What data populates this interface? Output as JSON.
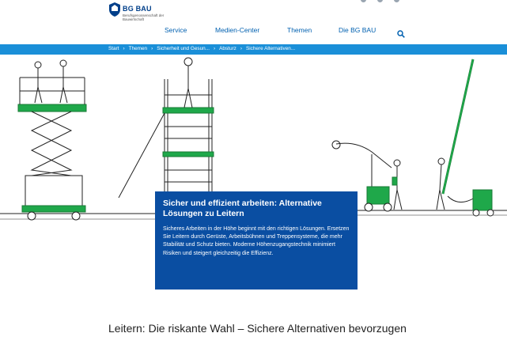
{
  "logo": {
    "title": "BG BAU",
    "subtitle": "Berufsgenossenschaft der Bauwirtschaft"
  },
  "nav": {
    "items": [
      "Service",
      "Medien-Center",
      "Themen",
      "Die BG BAU"
    ]
  },
  "breadcrumb": [
    "Start",
    "Themen",
    "Sicherheit und Gesun...",
    "Absturz",
    "Sichere Alternativen..."
  ],
  "hero_card": {
    "title": "Sicher und effizient arbeiten: Alternative Lösungen zu Leitern",
    "text": "Sicheres Arbeiten in der Höhe beginnt mit den richtigen Lösungen. Ersetzen Sie Leitern durch Gerüste, Arbeitsbühnen und Treppensysteme, die mehr Stabilität und Schutz bieten. Moderne Höhenzugangstechnik minimiert Risiken und steigert gleichzeitig die Effizienz."
  },
  "heading": "Leitern: Die riskante Wahl – Sichere Alternativen bevorzugen",
  "colors": {
    "brand_blue": "#0a4ea2",
    "breadcrumb_blue": "#1a8fd8",
    "nav_link": "#0060b0",
    "illustration_green": "#1fa84a"
  },
  "icons": [
    "search-icon",
    "chevron-right-icon"
  ]
}
